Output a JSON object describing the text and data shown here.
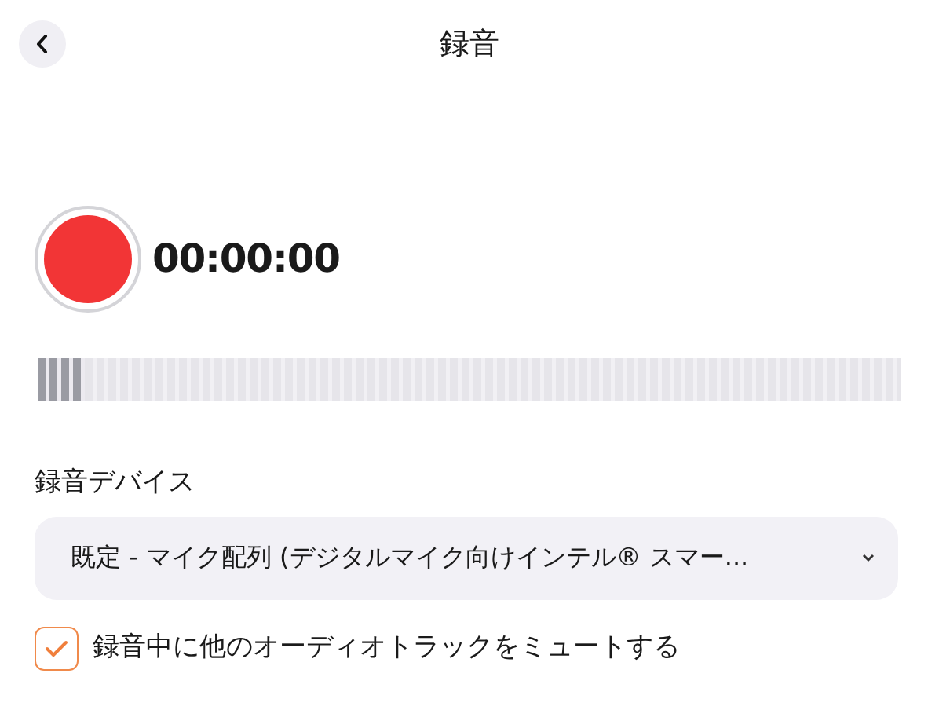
{
  "header": {
    "title": "録音"
  },
  "recorder": {
    "recording": false,
    "time": "00:00:00"
  },
  "meter": {
    "level": 0.055
  },
  "device": {
    "label": "録音デバイス",
    "value": "既定 - マイク配列 (デジタルマイク向けインテル® スマー..."
  },
  "mute_option": {
    "label": "録音中に他のオーディオトラックをミュートする",
    "checked": true
  }
}
